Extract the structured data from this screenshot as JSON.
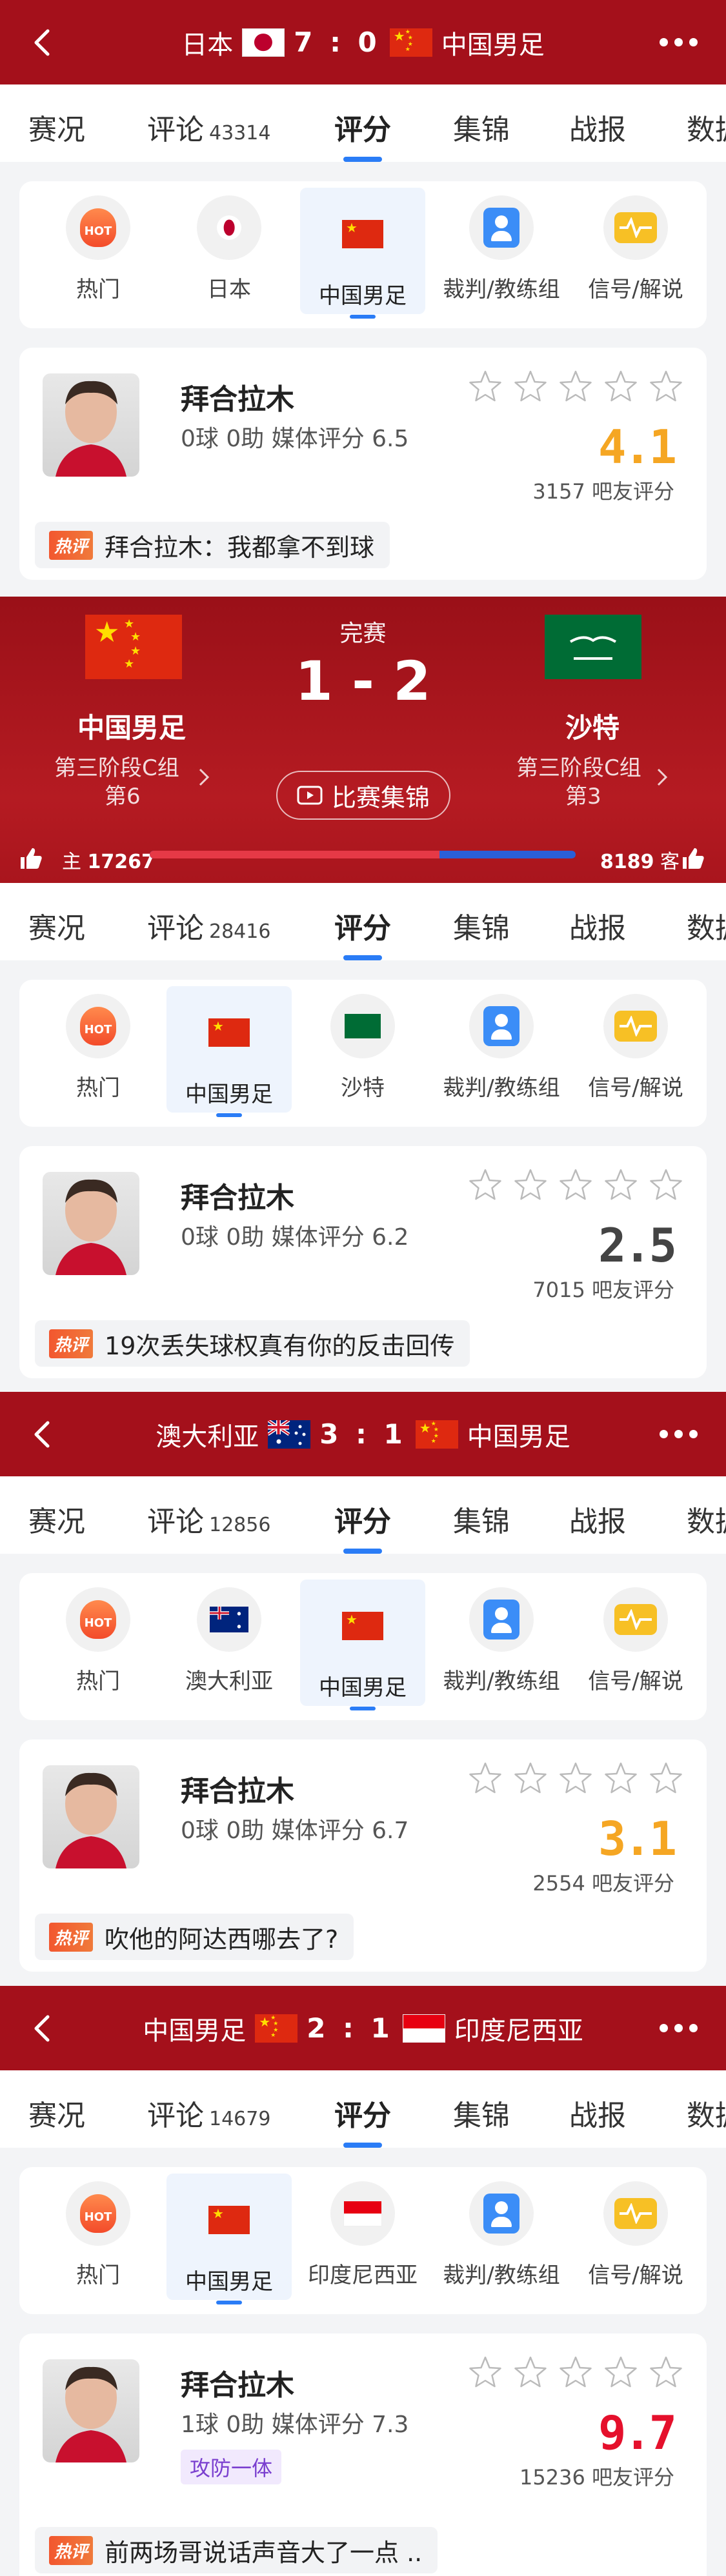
{
  "header1": {
    "home": "日本",
    "score": "7 : 0",
    "away": "中国男足"
  },
  "tabs1": [
    {
      "label": "赛况",
      "count": ""
    },
    {
      "label": "评论",
      "count": "43314"
    },
    {
      "label": "评分",
      "count": ""
    },
    {
      "label": "集锦",
      "count": ""
    },
    {
      "label": "战报",
      "count": ""
    },
    {
      "label": "数据",
      "count": ""
    }
  ],
  "cats1": [
    "热门",
    "日本",
    "中国男足",
    "裁判/教练组",
    "信号/解说"
  ],
  "player1": {
    "name": "拜合拉木",
    "stats": "0球 0助  媒体评分 6.5",
    "rating": "4.1",
    "votes": "3157 吧友评分",
    "hot_label": "热评",
    "comment": "拜合拉木：我都拿不到球"
  },
  "match": {
    "status": "完赛",
    "score": "1 - 2",
    "home": "中国男足",
    "home_stage": "第三阶段C组",
    "home_rank": "第6",
    "away": "沙特",
    "away_stage": "第三阶段C组",
    "away_rank": "第3",
    "highlights": "比赛集锦",
    "home_label": "主",
    "home_likes": "17267",
    "away_likes": "8189",
    "away_label": "客",
    "home_share": 0.68
  },
  "tabs2": [
    {
      "label": "赛况",
      "count": ""
    },
    {
      "label": "评论",
      "count": "28416"
    },
    {
      "label": "评分",
      "count": ""
    },
    {
      "label": "集锦",
      "count": ""
    },
    {
      "label": "战报",
      "count": ""
    },
    {
      "label": "数据",
      "count": ""
    }
  ],
  "cats2": [
    "热门",
    "中国男足",
    "沙特",
    "裁判/教练组",
    "信号/解说"
  ],
  "player2": {
    "name": "拜合拉木",
    "stats": "0球 0助  媒体评分 6.2",
    "rating": "2.5",
    "votes": "7015 吧友评分",
    "hot_label": "热评",
    "comment": "19次丢失球权真有你的反击回传"
  },
  "header3": {
    "home": "澳大利亚",
    "score": "3 : 1",
    "away": "中国男足"
  },
  "tabs3": [
    {
      "label": "赛况",
      "count": ""
    },
    {
      "label": "评论",
      "count": "12856"
    },
    {
      "label": "评分",
      "count": ""
    },
    {
      "label": "集锦",
      "count": ""
    },
    {
      "label": "战报",
      "count": ""
    },
    {
      "label": "数据",
      "count": ""
    }
  ],
  "cats3": [
    "热门",
    "澳大利亚",
    "中国男足",
    "裁判/教练组",
    "信号/解说"
  ],
  "player3": {
    "name": "拜合拉木",
    "stats": "0球 0助  媒体评分 6.7",
    "rating": "3.1",
    "votes": "2554 吧友评分",
    "hot_label": "热评",
    "comment": "吹他的阿达西哪去了?"
  },
  "header4": {
    "home": "中国男足",
    "score": "2 : 1",
    "away": "印度尼西亚"
  },
  "tabs4": [
    {
      "label": "赛况",
      "count": ""
    },
    {
      "label": "评论",
      "count": "14679"
    },
    {
      "label": "评分",
      "count": ""
    },
    {
      "label": "集锦",
      "count": ""
    },
    {
      "label": "战报",
      "count": ""
    },
    {
      "label": "数据",
      "count": ""
    }
  ],
  "cats4": [
    "热门",
    "中国男足",
    "印度尼西亚",
    "裁判/教练组",
    "信号/解说"
  ],
  "player4": {
    "name": "拜合拉木",
    "stats": "1球 0助  媒体评分 7.3",
    "tag": "攻防一体",
    "rating": "9.7",
    "votes": "15236 吧友评分",
    "hot_label": "热评",
    "comment": "前两场哥说话声音大了一点 .."
  },
  "colors": {
    "header_red": "#a4101b",
    "accent_blue": "#2a7cf6",
    "rating_orange": "#f5a623",
    "rating_red": "#e5102c"
  }
}
